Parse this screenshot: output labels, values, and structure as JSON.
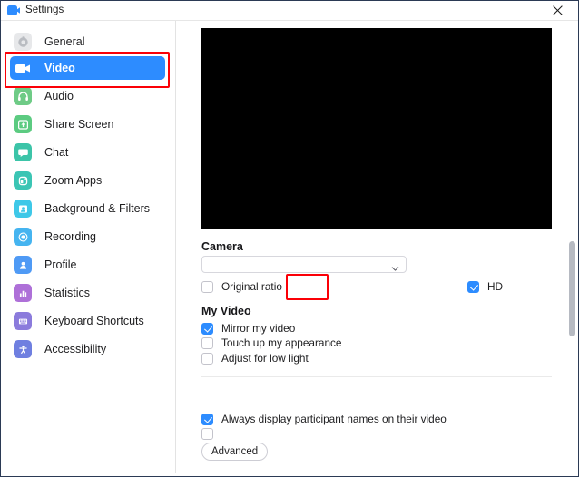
{
  "window": {
    "title": "Settings",
    "app_icon": "zoom-video-icon",
    "close_label": "×"
  },
  "colors": {
    "accent": "#2d8cff",
    "highlight_box": "#fb0007",
    "preview_background": "#000000",
    "text": "#1d1d1f"
  },
  "sidebar": {
    "items": [
      {
        "label": "General",
        "icon": "gear-icon",
        "icon_color": "#b9bcc1",
        "active": false
      },
      {
        "label": "Video",
        "icon": "video-camera-icon",
        "icon_color": "#2d8cff",
        "active": true
      },
      {
        "label": "Audio",
        "icon": "headphones-icon",
        "icon_color": "#56c271",
        "active": false
      },
      {
        "label": "Share Screen",
        "icon": "share-screen-icon",
        "icon_color": "#4dc878",
        "active": false
      },
      {
        "label": "Chat",
        "icon": "chat-bubble-icon",
        "icon_color": "#3cc4a8",
        "active": false
      },
      {
        "label": "Zoom Apps",
        "icon": "zoom-apps-icon",
        "icon_color": "#3bc5b4",
        "active": false
      },
      {
        "label": "Background & Filters",
        "icon": "background-filters-icon",
        "icon_color": "#3ec8e8",
        "active": false
      },
      {
        "label": "Recording",
        "icon": "recording-icon",
        "icon_color": "#45b4f0",
        "active": false
      },
      {
        "label": "Profile",
        "icon": "profile-person-icon",
        "icon_color": "#4f9af5",
        "active": false
      },
      {
        "label": "Statistics",
        "icon": "statistics-bars-icon",
        "icon_color": "#ae70d8",
        "active": false
      },
      {
        "label": "Keyboard Shortcuts",
        "icon": "keyboard-icon",
        "icon_color": "#8b7bdc",
        "active": false
      },
      {
        "label": "Accessibility",
        "icon": "accessibility-icon",
        "icon_color": "#6f7fe0",
        "active": false
      }
    ]
  },
  "main": {
    "preview": {
      "name": "video-preview",
      "state": "black"
    },
    "camera": {
      "title": "Camera",
      "selected": "",
      "placeholder": "",
      "chevron": "chevron-down-icon"
    },
    "camera_options": [
      {
        "label": "Original ratio",
        "checked": false
      },
      {
        "label": "HD",
        "checked": true
      }
    ],
    "my_video": {
      "title": "My Video",
      "options": [
        {
          "label": "Mirror my video",
          "checked": true
        },
        {
          "label": "Touch up my appearance",
          "checked": false
        },
        {
          "label": "Adjust for low light",
          "checked": false
        }
      ]
    },
    "more_options": [
      {
        "label": "Always display participant names on their video",
        "checked": true
      },
      {
        "label": "",
        "checked": false
      }
    ],
    "advanced_button": "Advanced"
  }
}
